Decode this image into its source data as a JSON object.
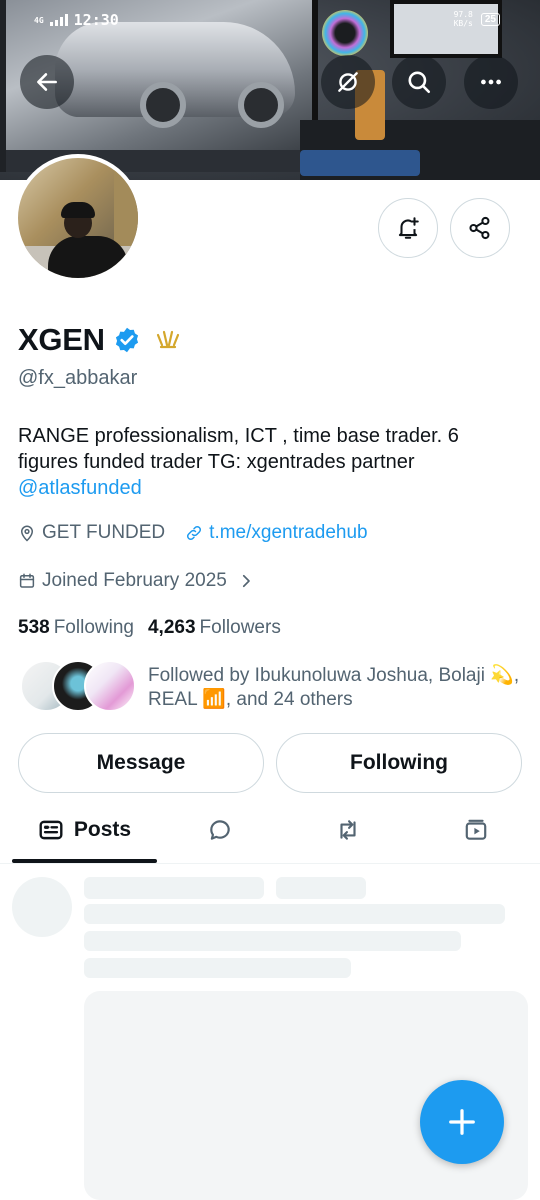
{
  "status_bar": {
    "network": "4G",
    "time": "12:30",
    "speed_value": "97.8",
    "speed_unit": "KB/s",
    "battery": "25"
  },
  "profile": {
    "name": "XGEN",
    "handle": "@fx_abbakar",
    "bio": "RANGE professionalism, ICT , time base trader. 6 figures funded trader TG: xgentrades partner",
    "bio_mention": "@atlasfunded",
    "location": "GET FUNDED",
    "website": "t.me/xgentradehub",
    "joined": "Joined February 2025",
    "following_count": "538",
    "following_label": "Following",
    "followers_count": "4,263",
    "followers_label": "Followers",
    "followed_by": "Followed by Ibukunoluwa Joshua, Bolaji 💫, REAL 📶, and 24 others"
  },
  "actions": {
    "message": "Message",
    "following": "Following"
  },
  "tabs": {
    "posts": "Posts"
  },
  "icons": {
    "back": "arrow-left-icon",
    "grok": "grok-icon",
    "search": "search-icon",
    "more": "more-icon",
    "notify": "bell-plus-icon",
    "share": "share-icon",
    "verified": "verified-badge-icon",
    "crown": "crown-icon",
    "location": "location-pin-icon",
    "link": "link-icon",
    "calendar": "calendar-icon",
    "chevron": "chevron-right-icon",
    "replies": "speech-bubble-icon",
    "reposts": "repost-icon",
    "media": "media-icon",
    "compose": "plus-icon"
  },
  "colors": {
    "accent": "#1d9bf0",
    "text": "#0f1419",
    "secondary": "#536471",
    "gold": "#d4a72c"
  }
}
